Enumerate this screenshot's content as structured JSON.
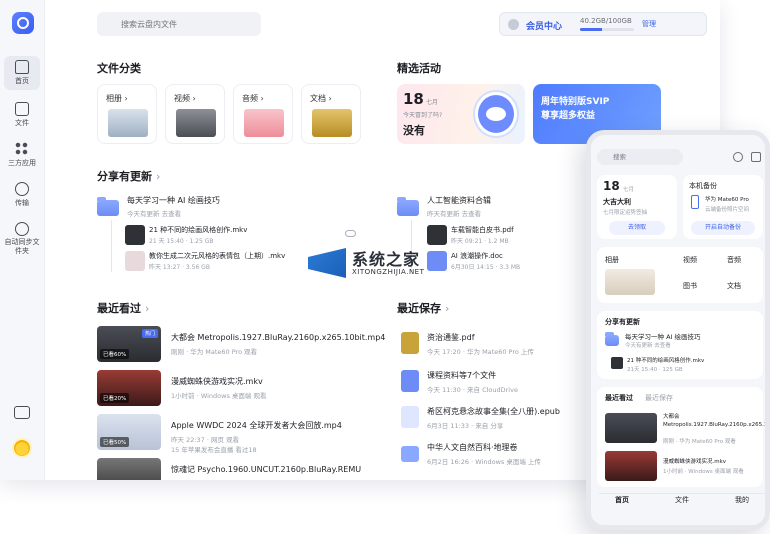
{
  "search": {
    "placeholder": "搜索云盘内文件"
  },
  "member": {
    "label": "会员中心",
    "quota": "40.2GB/100GB",
    "used_fraction": 0.4,
    "manage": "管理"
  },
  "sidebar": {
    "items": [
      {
        "label": "首页",
        "icon": "home-icon"
      },
      {
        "label": "文件",
        "icon": "folder-icon"
      },
      {
        "label": "三方应用",
        "icon": "apps-grid-icon"
      },
      {
        "label": "传输",
        "icon": "transfer-icon"
      },
      {
        "label": "自动同步文件夹",
        "icon": "sync-icon"
      }
    ]
  },
  "categories": {
    "title": "文件分类",
    "items": [
      {
        "label": "相册",
        "color": "#b8c7d8"
      },
      {
        "label": "视频",
        "color": "#6d6f76"
      },
      {
        "label": "音频",
        "color": "#f3a5ae"
      },
      {
        "label": "文档",
        "color": "#c8a33a"
      }
    ]
  },
  "activities": {
    "title": "精选活动",
    "date_day": "18",
    "date_month": "七月",
    "question": "今天冒到了吗?",
    "answer": "没有",
    "promo_line1": "周年特别版SVIP",
    "promo_line2": "尊享超多权益",
    "promo_badge": "福利"
  },
  "shares": {
    "title": "分享有更新",
    "left": {
      "title": "每天学习一种 AI 绘画技巧",
      "meta": "今天有更新  去查看",
      "files": [
        {
          "name": "21 种不同的绘画风格创作.mkv",
          "meta": "21 天 15:40 · 1.25 GB"
        },
        {
          "name": "教你生成二次元风格的表情包（上期）.mkv",
          "meta": "昨天 13:27 · 3.56 GB"
        }
      ]
    },
    "right": {
      "title": "人工智能资料合辑",
      "meta": "昨天有更新  去查看",
      "files": [
        {
          "name": "车载智能白皮书.pdf",
          "meta": "昨天 09:21 · 1.2 MB"
        },
        {
          "name": "AI 浪潮操作.doc",
          "meta": "6月30日 14:15 · 3.3 MB"
        }
      ]
    }
  },
  "recent": {
    "title": "最近看过",
    "items": [
      {
        "name": "大都会 Metropolis.1927.BluRay.2160p.x265.10bit.mp4",
        "meta": "刚刚 · 华为 Mate60 Pro 观看",
        "progress": "已看60%",
        "vip": "热门",
        "color": "#3a3d44"
      },
      {
        "name": "漫威蜘蛛侠游戏实况.mkv",
        "meta": "1小时前 · Windows 桌面端 观看",
        "progress": "已看20%",
        "color": "#7a2a2a"
      },
      {
        "name": "Apple WWDC 2024 全球开发者大会回放.mp4",
        "meta": "昨天 22:37 · 网页 观看",
        "progress": "已看50%",
        "sub": "15 年苹果发布会直播 看过18",
        "color": "#c9d2e3"
      },
      {
        "name": "惊魂记 Psycho.1960.UNCUT.2160p.BluRay.REMU",
        "meta": "",
        "progress": "",
        "color": "#555"
      }
    ]
  },
  "saved": {
    "title": "最近保存",
    "items": [
      {
        "name": "资治通鉴.pdf",
        "meta": "今天 17:20 · 华为 Mate60 Pro 上传",
        "color": "#c8a33a"
      },
      {
        "name": "课程资料等7个文件",
        "meta": "今天 11:30 · 来自 CloudDrive",
        "color": "#6d8cf5"
      },
      {
        "name": "希区柯克悬念故事全集(全八册).epub",
        "meta": "6月3日 11:33 · 来自 分享",
        "color": "#dfe6ff"
      },
      {
        "name": "中华人文自然百科·地理卷",
        "meta": "6月2日 16:26 · Windows 桌面端 上传",
        "color": "#8aa8ff"
      }
    ]
  },
  "watermark": {
    "cn": "系统之家",
    "en": "XITONGZHIJIA.NET"
  },
  "phone": {
    "search": "搜索",
    "luck_day": "18",
    "luck_month": "七月",
    "luck_title": "大吉大利",
    "luck_sub": "七月限定运势签抽",
    "luck_btn": "去领取",
    "backup_title": "本机备份",
    "backup_device": "华为 Mate60 Pro",
    "backup_sub": "云端备份照片空间",
    "backup_btn": "开启自动备份",
    "shortcuts": [
      "相册",
      "视频",
      "音频",
      "图书",
      "文档"
    ],
    "share_title": "分享有更新",
    "share_item": "每天学习一种 AI 绘画技巧",
    "share_item_meta": "今天有更新  去查看",
    "share_file": "21 种不同的绘画风格创作.mkv",
    "share_file_meta": "21天 15:40 · 125 GB",
    "recent_tab1": "最近看过",
    "recent_tab2": "最近保存",
    "recent_items": [
      {
        "name": "大都会 Metropolis.1927.BluRay.2160p.x265.10bit.mp4",
        "meta": "刚刚 · 华为 Mate60 Pro 观看"
      },
      {
        "name": "漫威蜘蛛侠游戏实况.mkv",
        "meta": "1小时前 · Windows 桌面端 观看"
      }
    ],
    "tabs": [
      "首页",
      "文件",
      "我的"
    ]
  }
}
